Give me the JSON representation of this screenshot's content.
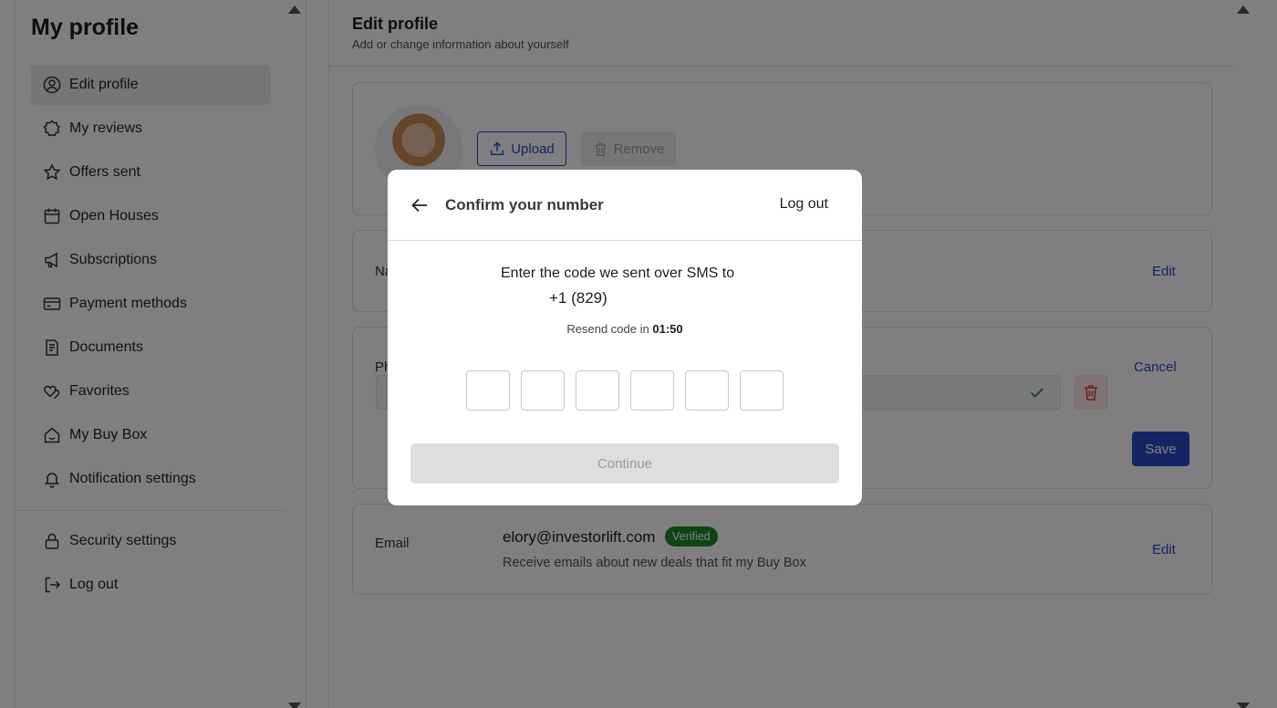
{
  "sidebar": {
    "title": "My profile",
    "items": [
      {
        "label": "Edit profile",
        "icon": "user-circle-icon",
        "active": true
      },
      {
        "label": "My reviews",
        "icon": "badge-star-icon"
      },
      {
        "label": "Offers sent",
        "icon": "star-icon"
      },
      {
        "label": "Open Houses",
        "icon": "calendar-icon"
      },
      {
        "label": "Subscriptions",
        "icon": "megaphone-icon"
      },
      {
        "label": "Payment methods",
        "icon": "credit-card-icon"
      },
      {
        "label": "Documents",
        "icon": "document-icon"
      },
      {
        "label": "Favorites",
        "icon": "hearts-icon"
      },
      {
        "label": "My Buy Box",
        "icon": "home-icon"
      },
      {
        "label": "Notification settings",
        "icon": "bell-icon"
      }
    ],
    "bottom_items": [
      {
        "label": "Security settings",
        "icon": "lock-icon"
      },
      {
        "label": "Log out",
        "icon": "logout-icon"
      }
    ]
  },
  "main": {
    "title": "Edit profile",
    "subtitle": "Add or change information about yourself",
    "photo": {
      "upload_label": "Upload",
      "remove_label": "Remove"
    },
    "name_row": {
      "label": "Na",
      "edit_label": "Edit"
    },
    "phone_row": {
      "label": "Ph",
      "cancel_label": "Cancel",
      "save_label": "Save"
    },
    "email_row": {
      "label": "Email",
      "value": "elory@investorlift.com",
      "badge": "Verified",
      "note": "Receive emails about new deals that fit my Buy Box",
      "edit_label": "Edit"
    }
  },
  "modal": {
    "title": "Confirm your number",
    "logout_label": "Log out",
    "instruction": "Enter the code we sent over SMS to",
    "phone": "+1 (829)",
    "resend_prefix": "Resend code in",
    "resend_timer": "01:50",
    "code_length": 6,
    "continue_label": "Continue"
  },
  "colors": {
    "accent": "#2a49c6",
    "verified": "#1f8a2a",
    "danger": "#d64545",
    "success": "#2e8b3a"
  }
}
